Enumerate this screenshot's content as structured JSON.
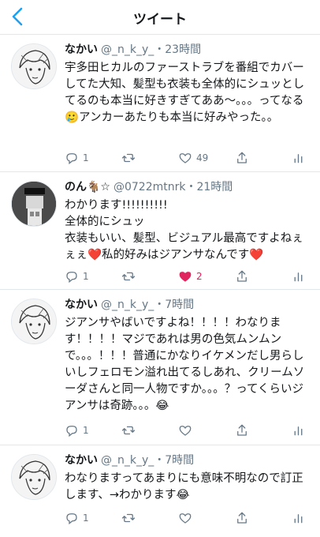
{
  "header": {
    "title": "ツイート"
  },
  "tweets": [
    {
      "name": "なかい",
      "handle": "@_n_k_y_",
      "time": "23時間",
      "text": "宇多田ヒカルのファーストラブを番組でカバーしてた大知、髪型も衣装も全体的にシュッとしてるのも本当に好きすぎてああ〜。。。ってなる🥲アンカーあたりも本当に好みやった。。",
      "reply_count": "1",
      "retweet_count": "",
      "like_count": "49",
      "liked": false
    },
    {
      "name": "のん🐐☆",
      "handle": "@0722mtnrk",
      "time": "21時間",
      "text": "わかります!!!!!!!!!!\n全体的にシュッ\n衣装もいい、髪型、ビジュアル最高ですよねぇぇぇ❤️私的好みはジアンサなんです❤️",
      "reply_count": "1",
      "retweet_count": "",
      "like_count": "2",
      "liked": true
    },
    {
      "name": "なかい",
      "handle": "@_n_k_y_",
      "time": "7時間",
      "text": "ジアンサやばいですよね！！！！わなります！！！！マジであれは男の色気ムンムンで。。。！！！普通にかなりイケメンだし男らしいしフェロモン溢れ出てるしあれ、クリームソーダさんと同一人物ですか。。。？ってくらいジアンサは奇跡。。。😂",
      "reply_count": "1",
      "retweet_count": "",
      "like_count": "",
      "liked": false
    },
    {
      "name": "なかい",
      "handle": "@_n_k_y_",
      "time": "7時間",
      "text": "わなりますってあまりにも意味不明なので訂正します、→わかります😂",
      "reply_count": "1",
      "retweet_count": "",
      "like_count": "",
      "liked": false
    }
  ],
  "icons": {
    "back": "chevron-left-icon",
    "reply": "reply-icon",
    "retweet": "retweet-icon",
    "like": "heart-icon",
    "share": "share-icon",
    "analytics": "analytics-icon"
  },
  "colors": {
    "accent": "#1da1f2",
    "like": "#e0245e",
    "secondary_text": "#657786",
    "divider": "#e1e8ed"
  }
}
